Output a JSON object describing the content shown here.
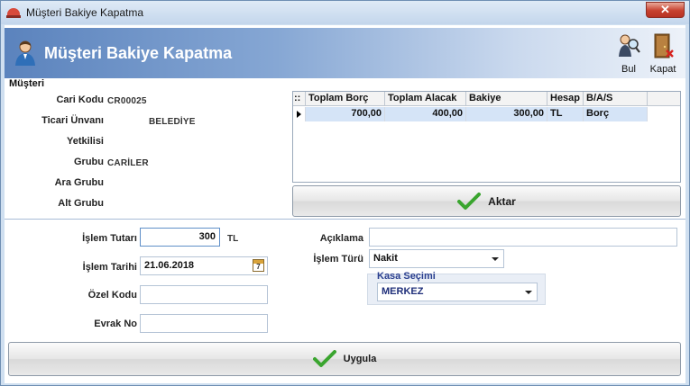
{
  "window": {
    "title": "Müşteri Bakiye Kapatma",
    "close_glyph": "✕"
  },
  "header": {
    "title": "Müşteri Bakiye Kapatma",
    "tools": [
      {
        "label": "Bul",
        "icon": "search-user-icon"
      },
      {
        "label": "Kapat",
        "icon": "exit-door-icon"
      }
    ]
  },
  "customer_group": {
    "title": "Müşteri",
    "fields": {
      "cari_kodu": {
        "label": "Cari Kodu",
        "value": "CR00025"
      },
      "ticari_unvani": {
        "label": "Ticari Ünvanı",
        "value": "BELEDİYE"
      },
      "yetkilisi": {
        "label": "Yetkilisi",
        "value": ""
      },
      "grubu": {
        "label": "Grubu",
        "value": "CARİLER"
      },
      "ara_grubu": {
        "label": "Ara Grubu",
        "value": ""
      },
      "alt_grubu": {
        "label": "Alt Grubu",
        "value": ""
      }
    }
  },
  "balance_grid": {
    "columns": [
      "::",
      "Toplam Borç",
      "Toplam Alacak",
      "Bakiye",
      "Hesap",
      "B/A/S"
    ],
    "rows": [
      {
        "toplam_borc": "700,00",
        "toplam_alacak": "400,00",
        "bakiye": "300,00",
        "hesap": "TL",
        "bas": "Borç"
      }
    ]
  },
  "aktar_button": {
    "label": "Aktar"
  },
  "form": {
    "islem_tutari": {
      "label": "İşlem Tutarı",
      "value": "300",
      "unit": "TL"
    },
    "islem_tarihi": {
      "label": "İşlem Tarihi",
      "value": "21.06.2018",
      "calendar_day": "7"
    },
    "ozel_kodu": {
      "label": "Özel Kodu",
      "value": ""
    },
    "evrak_no": {
      "label": "Evrak No",
      "value": ""
    },
    "aciklama": {
      "label": "Açıklama",
      "value": ""
    },
    "islem_turu": {
      "label": "İşlem Türü",
      "value": "Nakit"
    },
    "kasa_secimi": {
      "label": "Kasa Seçimi",
      "value": "MERKEZ"
    }
  },
  "uygula_button": {
    "label": "Uygula"
  },
  "colors": {
    "header_start": "#5b83bd",
    "check_green": "#3aa52f",
    "kasa_title": "#2a3f8f"
  }
}
